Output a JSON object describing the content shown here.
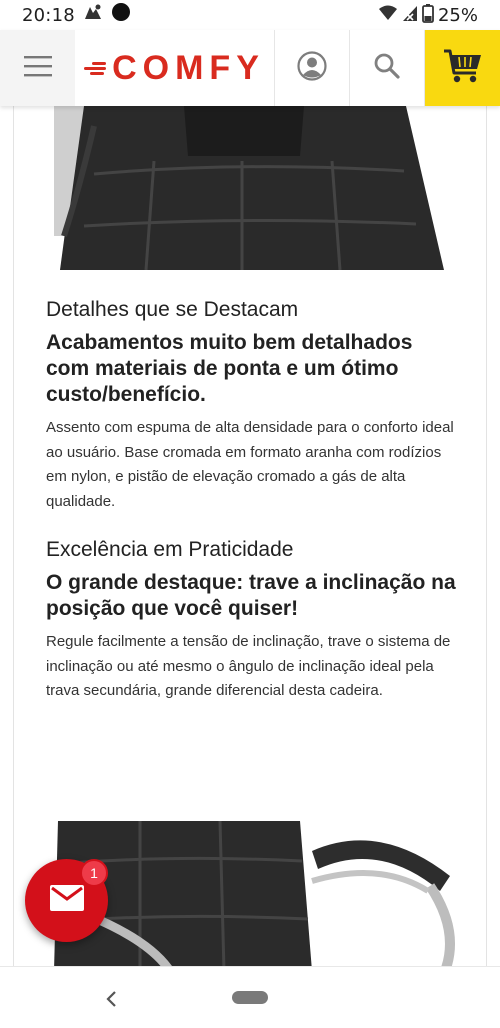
{
  "status_bar": {
    "time": "20:18",
    "battery": "25%"
  },
  "header": {
    "logo_text": "COMFY",
    "menu_icon": "hamburger-menu-icon",
    "account_icon": "user-account-icon",
    "search_icon": "search-icon",
    "cart_icon": "shopping-cart-icon",
    "brand_color": "#d92b1f",
    "cart_bg_color": "#f9d910"
  },
  "sections": [
    {
      "title": "Detalhes que se Destacam",
      "subtitle": "Acabamentos muito bem detalhados com materiais de ponta e um ótimo custo/benefício.",
      "body": "Assento com espuma de alta densidade para o conforto ideal ao usuário. Base cromada em formato aranha com rodízios em nylon, e pistão de elevação cromado a gás de alta qualidade."
    },
    {
      "title": "Excelência em Praticidade",
      "subtitle": "O grande destaque: trave a inclinação na posição que você quiser!",
      "body": "Regule facilmente a tensão de inclinação, trave o sistema de inclinação ou até mesmo o ângulo de inclinação ideal pela trava secundária, grande diferencial desta cadeira."
    }
  ],
  "fab": {
    "icon": "mail-icon",
    "badge_count": "1",
    "color": "#d3101a"
  },
  "nav_bar": {
    "back_icon": "back-chevron-icon",
    "home_icon": "home-pill-icon"
  }
}
